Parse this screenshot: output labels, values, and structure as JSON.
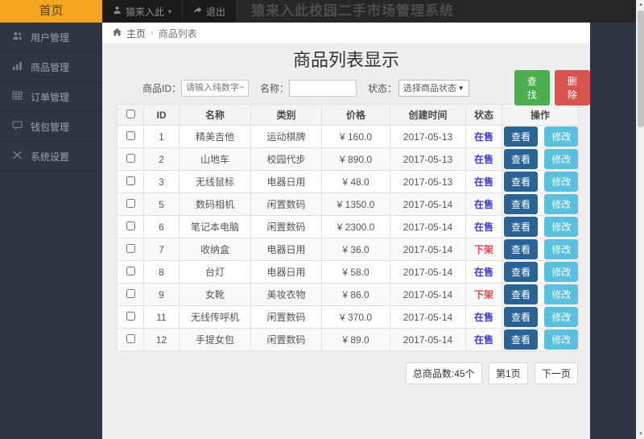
{
  "navbar": {
    "home": "首页",
    "user_menu": "猿来入此",
    "logout": "退出",
    "title": "猿来入此校园二手市场管理系统"
  },
  "sidebar": {
    "items": [
      {
        "label": "用户管理",
        "icon": "users-icon"
      },
      {
        "label": "商品管理",
        "icon": "chart-icon"
      },
      {
        "label": "订单管理",
        "icon": "table-icon"
      },
      {
        "label": "钱包管理",
        "icon": "wallet-icon"
      },
      {
        "label": "系统设置",
        "icon": "shuffle-icon"
      }
    ]
  },
  "breadcrumb": {
    "home": "主页",
    "current": "商品列表"
  },
  "page": {
    "title": "商品列表显示"
  },
  "filters": {
    "id_label": "商品ID：",
    "id_placeholder": "请输入纯数字~",
    "name_label": "名称：",
    "name_value": "",
    "status_label": "状态：",
    "status_selected": "选择商品状态",
    "search_btn": "查找",
    "delete_btn": "删除"
  },
  "table": {
    "headers": [
      "ID",
      "名称",
      "类别",
      "价格",
      "创建时间",
      "状态",
      "操作"
    ],
    "view_btn": "查看",
    "edit_btn": "修改",
    "rows": [
      {
        "id": "1",
        "name": "精美吉他",
        "category": "运动棋牌",
        "price": "¥ 160.0",
        "created": "2017-05-13",
        "status": "在售",
        "on_sale": true
      },
      {
        "id": "2",
        "name": "山地车",
        "category": "校园代步",
        "price": "¥ 890.0",
        "created": "2017-05-13",
        "status": "在售",
        "on_sale": true
      },
      {
        "id": "3",
        "name": "无线鼠标",
        "category": "电器日用",
        "price": "¥ 48.0",
        "created": "2017-05-13",
        "status": "在售",
        "on_sale": true
      },
      {
        "id": "5",
        "name": "数码相机",
        "category": "闲置数码",
        "price": "¥ 1350.0",
        "created": "2017-05-14",
        "status": "在售",
        "on_sale": true
      },
      {
        "id": "6",
        "name": "笔记本电脑",
        "category": "闲置数码",
        "price": "¥ 2300.0",
        "created": "2017-05-14",
        "status": "在售",
        "on_sale": true
      },
      {
        "id": "7",
        "name": "收纳盒",
        "category": "电器日用",
        "price": "¥ 36.0",
        "created": "2017-05-14",
        "status": "下架",
        "on_sale": false
      },
      {
        "id": "8",
        "name": "台灯",
        "category": "电器日用",
        "price": "¥ 58.0",
        "created": "2017-05-14",
        "status": "在售",
        "on_sale": true
      },
      {
        "id": "9",
        "name": "女靴",
        "category": "美妆衣物",
        "price": "¥ 86.0",
        "created": "2017-05-14",
        "status": "下架",
        "on_sale": false
      },
      {
        "id": "11",
        "name": "无线传呼机",
        "category": "闲置数码",
        "price": "¥ 370.0",
        "created": "2017-05-14",
        "status": "在售",
        "on_sale": true
      },
      {
        "id": "12",
        "name": "手提女包",
        "category": "闲置数码",
        "price": "¥ 89.0",
        "created": "2017-05-14",
        "status": "在售",
        "on_sale": true
      }
    ]
  },
  "pagination": {
    "total": "总商品数:45个",
    "page": "第1页",
    "next": "下一页"
  },
  "icons": {
    "caret_down_small": "▾",
    "select_caret": "▼",
    "breadcrumb_sep": "›",
    "scroll_up": "▲",
    "scroll_down": "▼"
  },
  "colors": {
    "brand_orange": "#f5a41d",
    "sidebar_bg": "#2f3542",
    "search_green": "#4cae4c",
    "delete_red": "#d9534f",
    "view_blue": "#2a6496",
    "edit_cyan": "#5bc0de",
    "status_on_sale": "#3c3cd9",
    "status_off_sale": "#e04b4b"
  }
}
